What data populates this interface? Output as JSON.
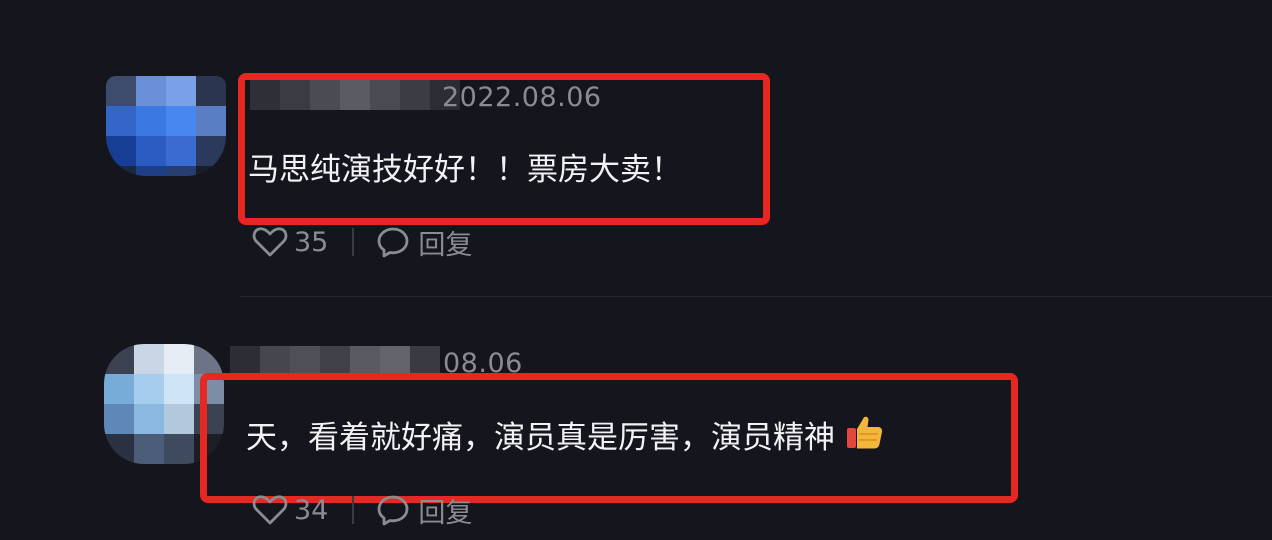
{
  "comments": [
    {
      "date": "2022.08.06",
      "text": "马思纯演技好好！！票房大卖！",
      "likes": "35",
      "reply_label": "回复",
      "emoji": "",
      "avatar_colors": [
        "#3d4c6c",
        "#6a8fd6",
        "#7aa0e8",
        "#2b3550",
        "#3466c9",
        "#3c78e2",
        "#4888ee",
        "#5a7ec4",
        "#163e94",
        "#2a5cc2",
        "#3a6bd0",
        "#2b3a5c",
        "#1c2740",
        "#1d3f86",
        "#263e70",
        "#1a1c26"
      ]
    },
    {
      "date": "08.06",
      "text": "天，看着就好痛，演员真是厉害，演员精神",
      "likes": "34",
      "reply_label": "回复",
      "emoji": "thumbs-up",
      "avatar_colors": [
        "#3b4150",
        "#c9d6e6",
        "#e6ecf4",
        "#6c7486",
        "#78acd8",
        "#a6cdee",
        "#cfe4f6",
        "#7c8ea6",
        "#5f88b8",
        "#8bb8e0",
        "#b2c9dd",
        "#3b4352",
        "#2a3140",
        "#4a5c78",
        "#3e4a5e",
        "#1c1e26"
      ]
    }
  ],
  "username_colors": [
    [
      "#2e2f37",
      "#3a3b43",
      "#4a4b53",
      "#5a5b63",
      "#4a4b52",
      "#3b3c44",
      "#2c2d34"
    ],
    [
      "#2d2e35",
      "#45464e",
      "#4e4f57",
      "#3f4048",
      "#585961",
      "#63646b",
      "#3a3b42"
    ]
  ],
  "colors": {
    "highlight": "#e52922",
    "background": "#15161d",
    "meta_text": "#8a8b93",
    "comment_text": "#f2f2f5"
  }
}
